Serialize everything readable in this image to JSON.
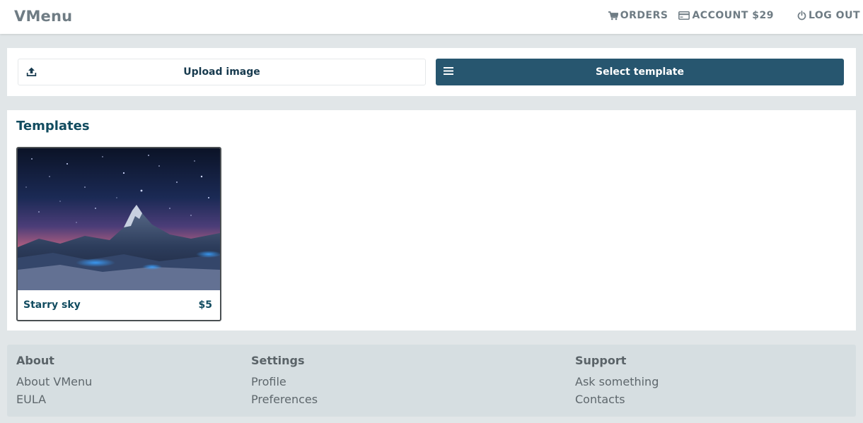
{
  "app": {
    "brand": "VMenu"
  },
  "nav": {
    "orders": "ORDERS",
    "account": "ACCOUNT $29",
    "logout": "LOG OUT"
  },
  "actions": {
    "upload_label": "Upload image",
    "select_label": "Select template"
  },
  "templates": {
    "title": "Templates",
    "items": [
      {
        "name": "Starry sky",
        "price": "$5"
      }
    ]
  },
  "footer": {
    "about": {
      "heading": "About",
      "links": [
        "About VMenu",
        "EULA"
      ]
    },
    "settings": {
      "heading": "Settings",
      "links": [
        "Profile",
        "Preferences"
      ]
    },
    "support": {
      "heading": "Support",
      "links": [
        "Ask something",
        "Contacts"
      ]
    }
  },
  "colors": {
    "primary": "#27566f",
    "page_bg": "#e1e6e8",
    "footer_bg": "#d6dee1",
    "heading": "#124c60"
  },
  "icons": {
    "orders": "cart-icon",
    "account": "credit-card-icon",
    "logout": "power-icon",
    "upload": "upload-icon",
    "select": "hamburger-icon"
  }
}
